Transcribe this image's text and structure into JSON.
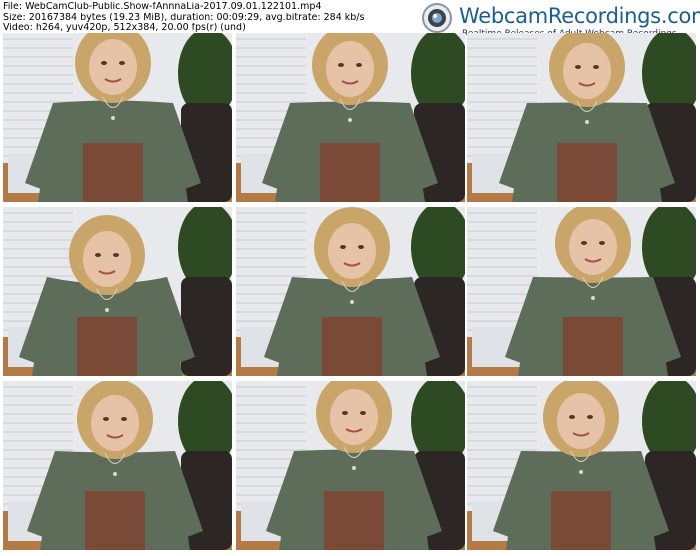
{
  "file_info": {
    "file_line": "File: WebCamClub-Public.Show-fAnnnaLia-2017.09.01.122101.mp4",
    "size_line": "Size: 20167384 bytes (19.23 MiB), duration: 00:09:29, avg.bitrate: 284 kb/s",
    "video_line": "Video: h264, yuv420p, 512x384, 20.00 fps(r) (und)"
  },
  "brand": {
    "name": "WebcamRecordings.com",
    "tagline": "Realtime Releases of Adult Webcam Recordings",
    "name_color": "#1c5e92",
    "tagline_color": "#1f2f5e",
    "icon": "webcam-icon"
  },
  "thumbnails": {
    "count": 9,
    "rows": 3,
    "columns": 3,
    "sweater_color": "#5d6d5a",
    "hair_color": "#c9a56a",
    "pants_color": "#7a4a36",
    "wall_color": "#e7e9ec",
    "floor_color": "#b47a45",
    "plant_color": "#2e4a22",
    "chair_color": "#2c2624"
  }
}
